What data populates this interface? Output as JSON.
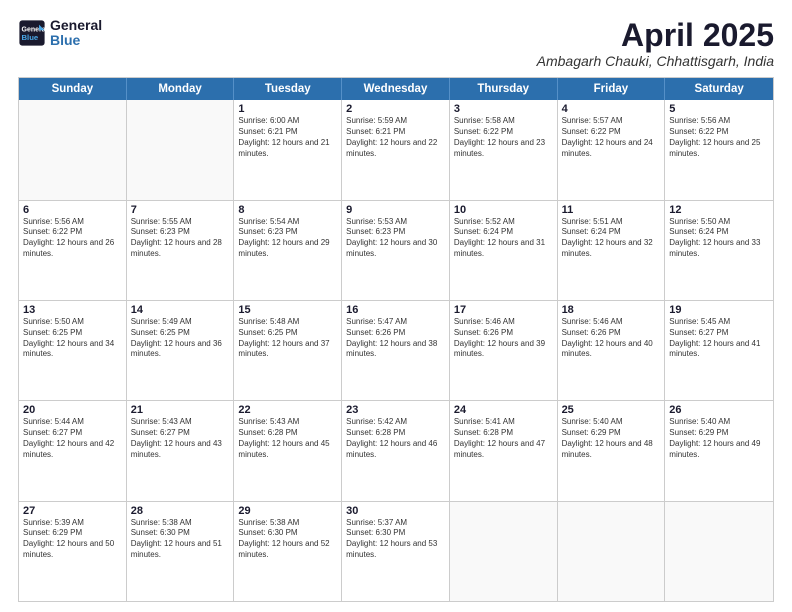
{
  "header": {
    "logo_line1": "General",
    "logo_line2": "Blue",
    "month": "April 2025",
    "location": "Ambagarh Chauki, Chhattisgarh, India"
  },
  "weekdays": [
    "Sunday",
    "Monday",
    "Tuesday",
    "Wednesday",
    "Thursday",
    "Friday",
    "Saturday"
  ],
  "rows": [
    [
      {
        "day": "",
        "info": ""
      },
      {
        "day": "",
        "info": ""
      },
      {
        "day": "1",
        "info": "Sunrise: 6:00 AM\nSunset: 6:21 PM\nDaylight: 12 hours and 21 minutes."
      },
      {
        "day": "2",
        "info": "Sunrise: 5:59 AM\nSunset: 6:21 PM\nDaylight: 12 hours and 22 minutes."
      },
      {
        "day": "3",
        "info": "Sunrise: 5:58 AM\nSunset: 6:22 PM\nDaylight: 12 hours and 23 minutes."
      },
      {
        "day": "4",
        "info": "Sunrise: 5:57 AM\nSunset: 6:22 PM\nDaylight: 12 hours and 24 minutes."
      },
      {
        "day": "5",
        "info": "Sunrise: 5:56 AM\nSunset: 6:22 PM\nDaylight: 12 hours and 25 minutes."
      }
    ],
    [
      {
        "day": "6",
        "info": "Sunrise: 5:56 AM\nSunset: 6:22 PM\nDaylight: 12 hours and 26 minutes."
      },
      {
        "day": "7",
        "info": "Sunrise: 5:55 AM\nSunset: 6:23 PM\nDaylight: 12 hours and 28 minutes."
      },
      {
        "day": "8",
        "info": "Sunrise: 5:54 AM\nSunset: 6:23 PM\nDaylight: 12 hours and 29 minutes."
      },
      {
        "day": "9",
        "info": "Sunrise: 5:53 AM\nSunset: 6:23 PM\nDaylight: 12 hours and 30 minutes."
      },
      {
        "day": "10",
        "info": "Sunrise: 5:52 AM\nSunset: 6:24 PM\nDaylight: 12 hours and 31 minutes."
      },
      {
        "day": "11",
        "info": "Sunrise: 5:51 AM\nSunset: 6:24 PM\nDaylight: 12 hours and 32 minutes."
      },
      {
        "day": "12",
        "info": "Sunrise: 5:50 AM\nSunset: 6:24 PM\nDaylight: 12 hours and 33 minutes."
      }
    ],
    [
      {
        "day": "13",
        "info": "Sunrise: 5:50 AM\nSunset: 6:25 PM\nDaylight: 12 hours and 34 minutes."
      },
      {
        "day": "14",
        "info": "Sunrise: 5:49 AM\nSunset: 6:25 PM\nDaylight: 12 hours and 36 minutes."
      },
      {
        "day": "15",
        "info": "Sunrise: 5:48 AM\nSunset: 6:25 PM\nDaylight: 12 hours and 37 minutes."
      },
      {
        "day": "16",
        "info": "Sunrise: 5:47 AM\nSunset: 6:26 PM\nDaylight: 12 hours and 38 minutes."
      },
      {
        "day": "17",
        "info": "Sunrise: 5:46 AM\nSunset: 6:26 PM\nDaylight: 12 hours and 39 minutes."
      },
      {
        "day": "18",
        "info": "Sunrise: 5:46 AM\nSunset: 6:26 PM\nDaylight: 12 hours and 40 minutes."
      },
      {
        "day": "19",
        "info": "Sunrise: 5:45 AM\nSunset: 6:27 PM\nDaylight: 12 hours and 41 minutes."
      }
    ],
    [
      {
        "day": "20",
        "info": "Sunrise: 5:44 AM\nSunset: 6:27 PM\nDaylight: 12 hours and 42 minutes."
      },
      {
        "day": "21",
        "info": "Sunrise: 5:43 AM\nSunset: 6:27 PM\nDaylight: 12 hours and 43 minutes."
      },
      {
        "day": "22",
        "info": "Sunrise: 5:43 AM\nSunset: 6:28 PM\nDaylight: 12 hours and 45 minutes."
      },
      {
        "day": "23",
        "info": "Sunrise: 5:42 AM\nSunset: 6:28 PM\nDaylight: 12 hours and 46 minutes."
      },
      {
        "day": "24",
        "info": "Sunrise: 5:41 AM\nSunset: 6:28 PM\nDaylight: 12 hours and 47 minutes."
      },
      {
        "day": "25",
        "info": "Sunrise: 5:40 AM\nSunset: 6:29 PM\nDaylight: 12 hours and 48 minutes."
      },
      {
        "day": "26",
        "info": "Sunrise: 5:40 AM\nSunset: 6:29 PM\nDaylight: 12 hours and 49 minutes."
      }
    ],
    [
      {
        "day": "27",
        "info": "Sunrise: 5:39 AM\nSunset: 6:29 PM\nDaylight: 12 hours and 50 minutes."
      },
      {
        "day": "28",
        "info": "Sunrise: 5:38 AM\nSunset: 6:30 PM\nDaylight: 12 hours and 51 minutes."
      },
      {
        "day": "29",
        "info": "Sunrise: 5:38 AM\nSunset: 6:30 PM\nDaylight: 12 hours and 52 minutes."
      },
      {
        "day": "30",
        "info": "Sunrise: 5:37 AM\nSunset: 6:30 PM\nDaylight: 12 hours and 53 minutes."
      },
      {
        "day": "",
        "info": ""
      },
      {
        "day": "",
        "info": ""
      },
      {
        "day": "",
        "info": ""
      }
    ]
  ]
}
